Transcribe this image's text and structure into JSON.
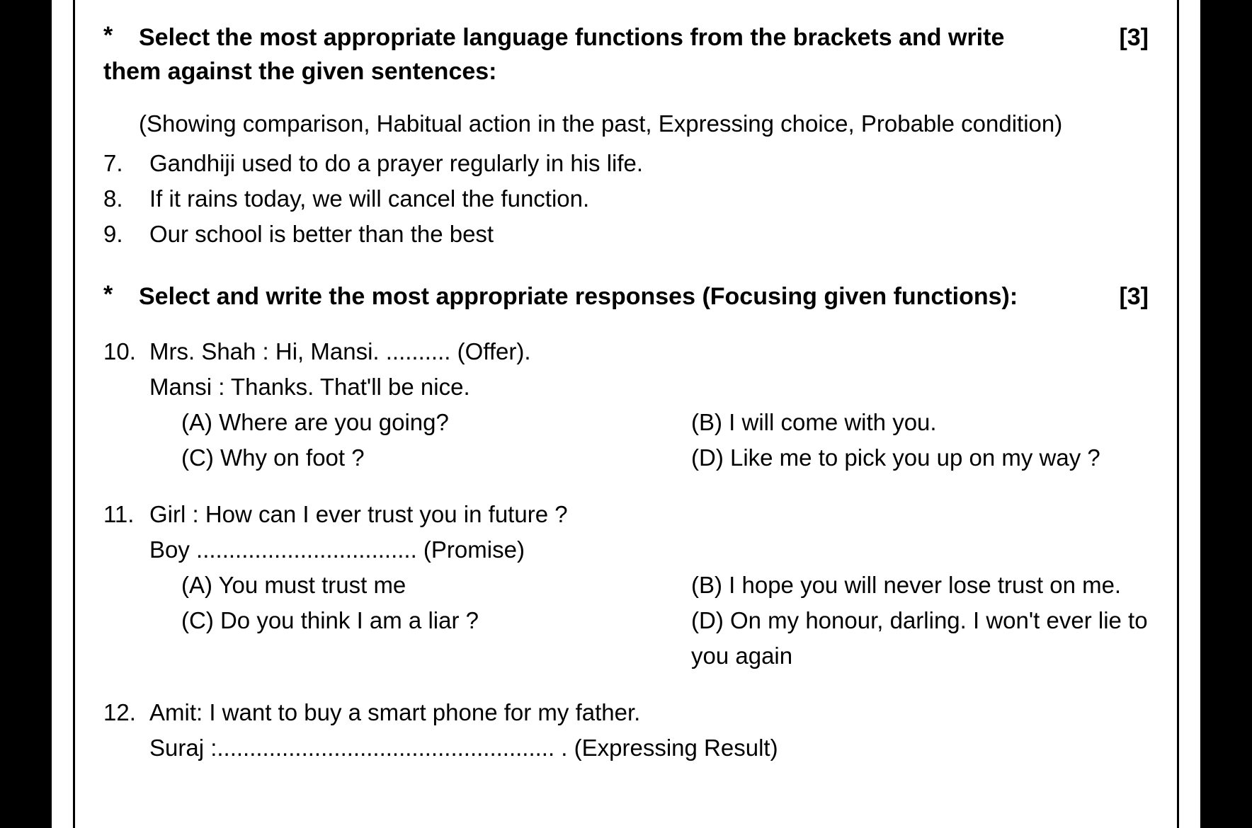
{
  "sectionA": {
    "bullet": "*",
    "heading_line1": "Select the most appropriate language functions from the brackets and write",
    "heading_line2": "them against the given sentences:",
    "marks": "[3]",
    "hint": "(Showing comparison, Habitual action in the past, Expressing choice, Probable condition)",
    "items": [
      {
        "num": "7.",
        "text": "Gandhiji used to do a prayer regularly in his life."
      },
      {
        "num": "8.",
        "text": "If it rains today, we will cancel the function."
      },
      {
        "num": "9.",
        "text": "Our school is better than the best"
      }
    ]
  },
  "sectionB": {
    "bullet": "*",
    "heading": "Select and write the most appropriate responses (Focusing given functions):",
    "marks": "[3]",
    "q10": {
      "num": "10.",
      "line1": "Mrs. Shah : Hi, Mansi. .......... (Offer).",
      "line2": "Mansi : Thanks. That'll be nice.",
      "optA": "(A) Where are you going?",
      "optB": "(B) I will come with you.",
      "optC": "(C) Why on foot ?",
      "optD": "(D) Like me to pick you up on my way ?"
    },
    "q11": {
      "num": "11.",
      "line1": "Girl : How can I ever trust you in future ?",
      "line2": "Boy .................................. (Promise)",
      "optA": "(A) You must trust me",
      "optB": "(B) I hope you will never lose trust on me.",
      "optC": "(C) Do you think I am a liar ?",
      "optD": "(D) On my honour, darling. I won't ever lie to you again"
    },
    "q12": {
      "num": "12.",
      "line1": "Amit: I want to buy a smart phone for my father.",
      "line2": "Suraj :.................................................... . (Expressing Result)"
    }
  }
}
